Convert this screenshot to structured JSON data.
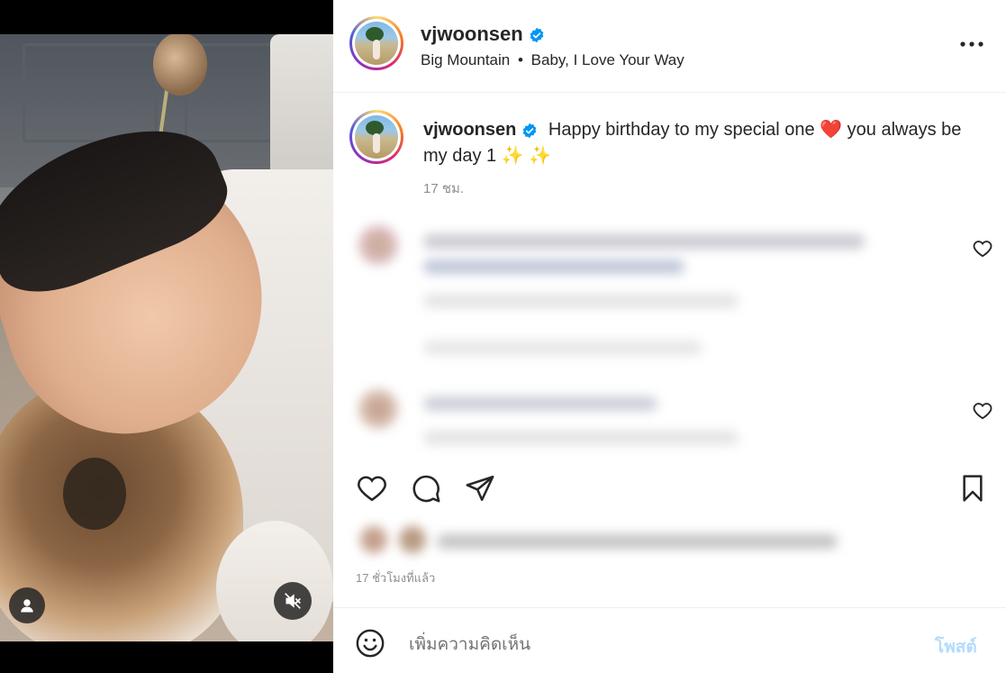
{
  "post": {
    "username": "vjwoonsen",
    "location": "Big Mountain",
    "audio": "Baby, I Love Your Way",
    "separator": "•"
  },
  "caption": {
    "username": "vjwoonsen",
    "text": "Happy birthday to my special one",
    "text_after_emoji": "you always be my day 1",
    "emoji_heart": "❤️",
    "emoji_sparkles": "✨ ✨",
    "time": "17 ชม."
  },
  "footer": {
    "posted_time": "17 ชั่วโมงที่แล้ว"
  },
  "comment_box": {
    "placeholder": "เพิ่มความคิดเห็น",
    "post_label": "โพสต์"
  },
  "colors": {
    "verified": "#0095f6",
    "post_button_disabled": "#b3dbff",
    "muted_text": "#8e8e8e"
  },
  "icons": {
    "more": "more-dots-icon",
    "like": "heart-icon",
    "comment": "comment-icon",
    "share": "send-icon",
    "save": "bookmark-icon",
    "emoji": "emoji-icon",
    "user_tag": "user-icon",
    "mute": "speaker-muted-icon"
  }
}
